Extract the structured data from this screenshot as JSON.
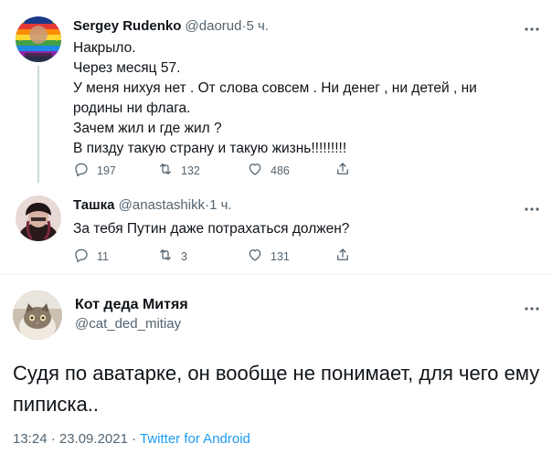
{
  "tweets": [
    {
      "name": "Sergey Rudenko",
      "handle": "@daorud",
      "separator": "·",
      "time": "5 ч.",
      "lines": [
        "Накрыло.",
        "Через месяц 57.",
        "У меня нихуя нет . От слова совсем . Ни денег , ни детей , ни родины ни флага.",
        "Зачем жил и где жил ?",
        "В пизду такую страну и такую жизнь!!!!!!!!!"
      ],
      "replies": "197",
      "retweets": "132",
      "likes": "486"
    },
    {
      "name": "Ташка",
      "handle": "@anastashikk",
      "separator": "·",
      "time": "1 ч.",
      "lines": [
        "За тебя Путин даже потрахаться должен?"
      ],
      "replies": "11",
      "retweets": "3",
      "likes": "131"
    }
  ],
  "main_tweet": {
    "name": "Кот деда Митяя",
    "handle": "@cat_ded_mitiay",
    "text": "Судя по аватарке, он вообще не понимает, для чего ему пиписка..",
    "timestamp": "13:24 · 23.09.2021 · ",
    "source": "Twitter for Android"
  },
  "icons": {
    "reply": "reply-icon",
    "retweet": "retweet-icon",
    "like": "heart-icon",
    "share": "share-icon",
    "more": "more-icon"
  },
  "colors": {
    "text": "#0f1419",
    "secondary": "#536471",
    "link": "#1d9bf0",
    "line": "#cfd9de"
  }
}
